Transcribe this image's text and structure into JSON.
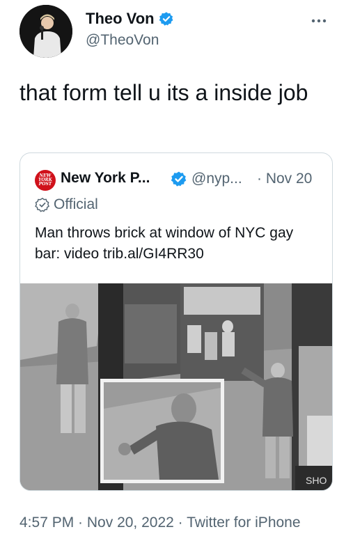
{
  "author": {
    "name": "Theo Von",
    "handle": "@TheoVon",
    "verified": true,
    "more_icon": "more-horizontal-icon"
  },
  "tweet": {
    "text": "that form tell u its a inside job"
  },
  "quoted": {
    "logo_text": "NEW YORK POST",
    "name": "New York P...",
    "handle": "@nyp...",
    "date": "· Nov 20",
    "official_label": "Official",
    "text": "Man throws brick at window of NYC gay bar: video trib.al/GI4RR30",
    "media_sign_text": "SHO"
  },
  "meta": {
    "time": "4:57 PM",
    "sep1": " · ",
    "date": "Nov 20, 2022",
    "sep2": " · ",
    "source": "Twitter for iPhone"
  },
  "colors": {
    "verified_blue": "#1d9bf0",
    "secondary_text": "#536471",
    "primary_text": "#0f1419",
    "border": "#cfd9de",
    "nypost_red": "#d0111b"
  }
}
